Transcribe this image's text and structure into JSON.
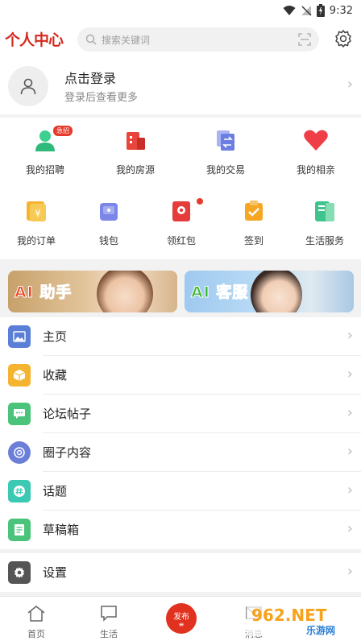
{
  "status_bar": {
    "time": "9:32",
    "icons": [
      "wifi-icon",
      "no-signal-icon",
      "battery-icon"
    ]
  },
  "header": {
    "title": "个人中心",
    "search_placeholder": "搜索关键词",
    "accent_color": "#d42a1e"
  },
  "login": {
    "title": "点击登录",
    "subtitle": "登录后查看更多"
  },
  "grid": {
    "row1": [
      {
        "label": "我的招聘",
        "badge": "急招",
        "icon": "recruit-icon",
        "color": "#3ccf8e"
      },
      {
        "label": "我的房源",
        "icon": "house-icon",
        "color": "#e8453c"
      },
      {
        "label": "我的交易",
        "icon": "trade-icon",
        "color": "#6c7ee1"
      },
      {
        "label": "我的相亲",
        "icon": "heart-icon",
        "color": "#ef3e45"
      }
    ],
    "row2": [
      {
        "label": "我的订单",
        "icon": "order-icon",
        "color": "#f5b430"
      },
      {
        "label": "钱包",
        "icon": "wallet-icon",
        "color": "#7b86e8"
      },
      {
        "label": "领红包",
        "icon": "red-packet-icon",
        "color": "#e53b3b"
      },
      {
        "label": "签到",
        "icon": "checkin-icon",
        "color": "#f5a623"
      },
      {
        "label": "生活服务",
        "icon": "life-service-icon",
        "color": "#3fc48d"
      }
    ]
  },
  "banners": [
    {
      "text": "AI 助手"
    },
    {
      "text": "AI 客服"
    }
  ],
  "menu": [
    {
      "label": "主页",
      "icon": "image-icon",
      "color": "#5b7fd6"
    },
    {
      "label": "收藏",
      "icon": "box-icon",
      "color": "#f5b430"
    },
    {
      "label": "论坛帖子",
      "icon": "chat-icon",
      "color": "#4cc37a"
    },
    {
      "label": "圈子内容",
      "icon": "circle-icon",
      "color": "#6b7fd8"
    },
    {
      "label": "话题",
      "icon": "hashtag-icon",
      "color": "#3cc9b4"
    },
    {
      "label": "草稿箱",
      "icon": "draft-icon",
      "color": "#4cc37a"
    }
  ],
  "settings": {
    "label": "设置",
    "icon": "gear-icon",
    "color": "#555555"
  },
  "tabbar": {
    "tabs": [
      {
        "label": "首页",
        "icon": "home-icon"
      },
      {
        "label": "生活",
        "icon": "message-square-icon"
      },
      {
        "label": "发布",
        "icon": "publish-icon"
      },
      {
        "label": "消息",
        "icon": "mail-icon"
      }
    ]
  },
  "watermark": {
    "text": "962.NET",
    "sub": "乐游网"
  }
}
